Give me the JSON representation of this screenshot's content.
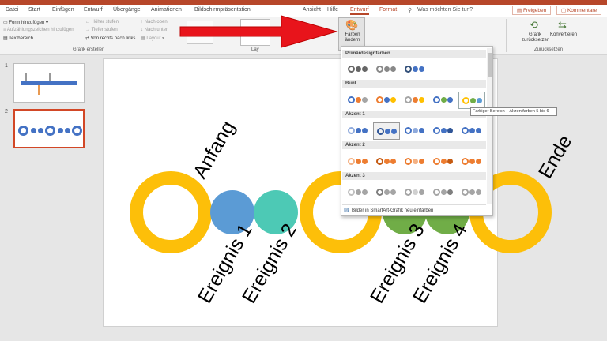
{
  "tabs": [
    "Datei",
    "Start",
    "Einfügen",
    "Entwurf",
    "Übergänge",
    "Animationen",
    "Bildschirmpräsentation",
    "Ansicht",
    "Hilfe",
    "Entwurf",
    "Format"
  ],
  "search": "Was möchten Sie tun?",
  "share_button": "Freigeben",
  "comments_button": "Kommentare",
  "ribbon": {
    "create_group": {
      "add_shape": "Form hinzufügen",
      "add_bullet": "Aufzählungszeichen hinzufügen",
      "right_to_left": "Von rechts nach links",
      "text_pane": "Textbereich",
      "promote": "Höher stufen",
      "demote": "Tiefer stufen",
      "layout": "Layout",
      "move_up": "Nach oben",
      "move_down": "Nach unten",
      "label": "Grafik erstellen"
    },
    "layouts_label": "Lay",
    "colors_button": "Farben ändern",
    "reset_graphic": "Grafik zurücksetzen",
    "convert": "Konvertieren",
    "reset_label": "Zurücksetzen"
  },
  "slides": [
    {
      "number": "1"
    },
    {
      "number": "2"
    }
  ],
  "slide": {
    "start_label": "Anfang",
    "end_label": "Ende",
    "events": [
      "Ereignis 1",
      "Ereignis 2",
      "Ereignis 3",
      "Ereignis 4"
    ],
    "colors": {
      "ring": "#fdbf09",
      "blue": "#5b9bd5",
      "teal": "#4dc9b5",
      "green": "#70ad47",
      "arrow": "#e8141b"
    }
  },
  "dropdown": {
    "sections": [
      "Primärdesignfarben",
      "Bunt",
      "Akzent 1",
      "Akzent 2",
      "Akzent 3"
    ],
    "footer": "Bilder in SmartArt-Grafik neu einfärben",
    "tooltip": "Farbiger Bereich – Akzentfarben 5 bis 6"
  }
}
